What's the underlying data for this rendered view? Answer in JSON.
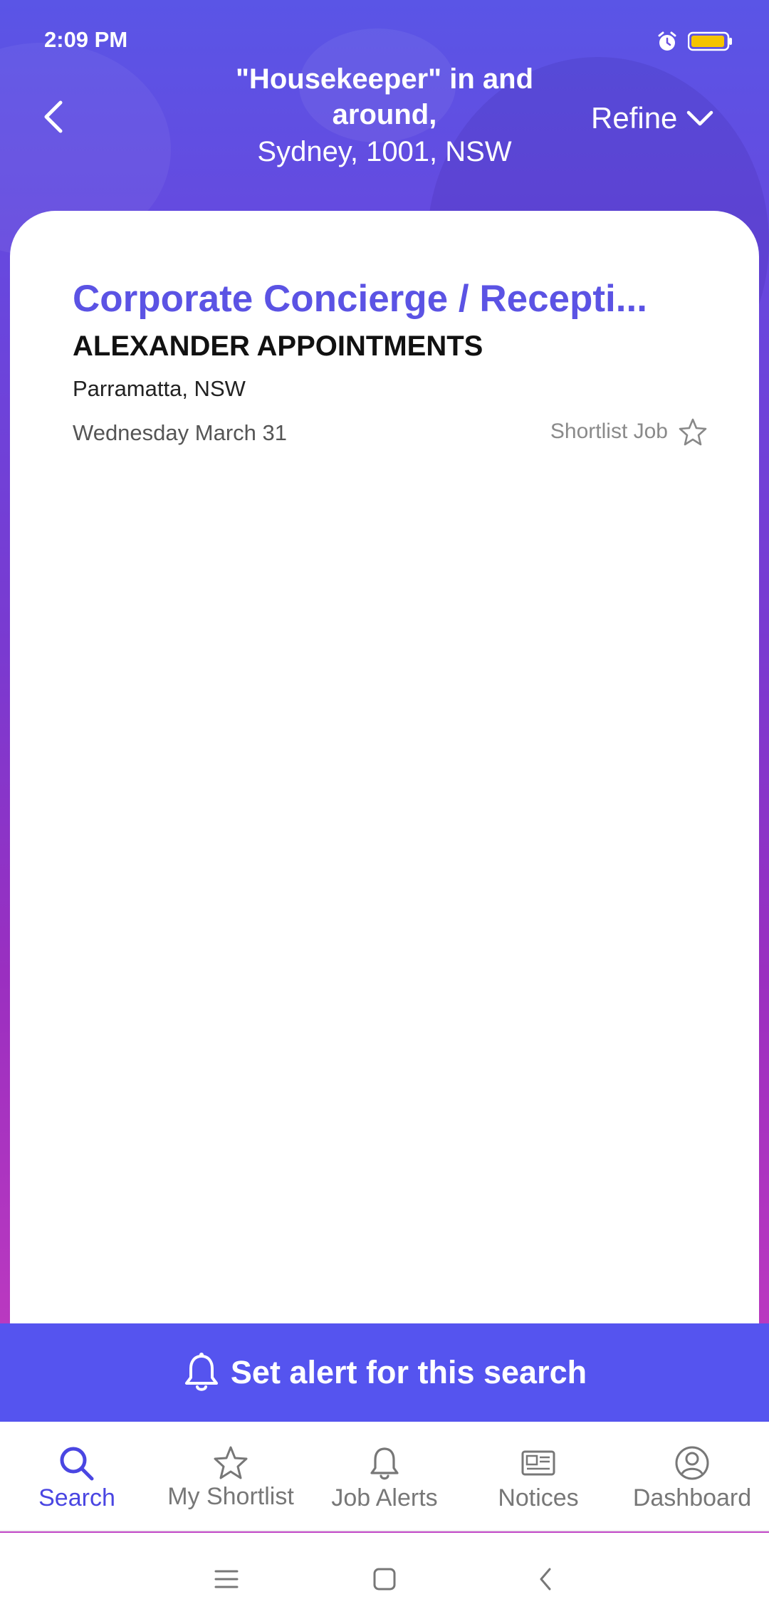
{
  "status_bar": {
    "time": "2:09 PM",
    "icons": [
      "alarm-icon",
      "battery-icon"
    ],
    "battery_color": "#f5c400"
  },
  "header": {
    "query_line": "\"Housekeeper\" in and around,",
    "location_line": "Sydney, 1001, NSW",
    "refine_label": "Refine",
    "back_icon": "chevron-left-icon",
    "refine_icon": "chevron-down-icon"
  },
  "results": [
    {
      "title": "Corporate Concierge / Recepti...",
      "company": "ALEXANDER APPOINTMENTS",
      "location": "Parramatta, NSW",
      "date": "Wednesday March 31",
      "shortlist_label": "Shortlist Job",
      "shortlist_icon": "star-outline-icon"
    }
  ],
  "alert_bar": {
    "label": "Set alert for this search",
    "icon": "bell-icon"
  },
  "bottom_nav": {
    "items": [
      {
        "label": "Search",
        "icon": "search-icon",
        "active": true
      },
      {
        "label": "My Shortlist",
        "icon": "star-outline-icon",
        "active": false
      },
      {
        "label": "Job Alerts",
        "icon": "bell-icon",
        "active": false
      },
      {
        "label": "Notices",
        "icon": "newspaper-icon",
        "active": false
      },
      {
        "label": "Dashboard",
        "icon": "user-circle-icon",
        "active": false
      }
    ]
  },
  "system_nav": {
    "buttons": [
      "menu-icon",
      "home-icon",
      "back-icon"
    ]
  },
  "colors": {
    "accent": "#5554ef",
    "title": "#5b53e4",
    "active_nav": "#4a46e2"
  }
}
